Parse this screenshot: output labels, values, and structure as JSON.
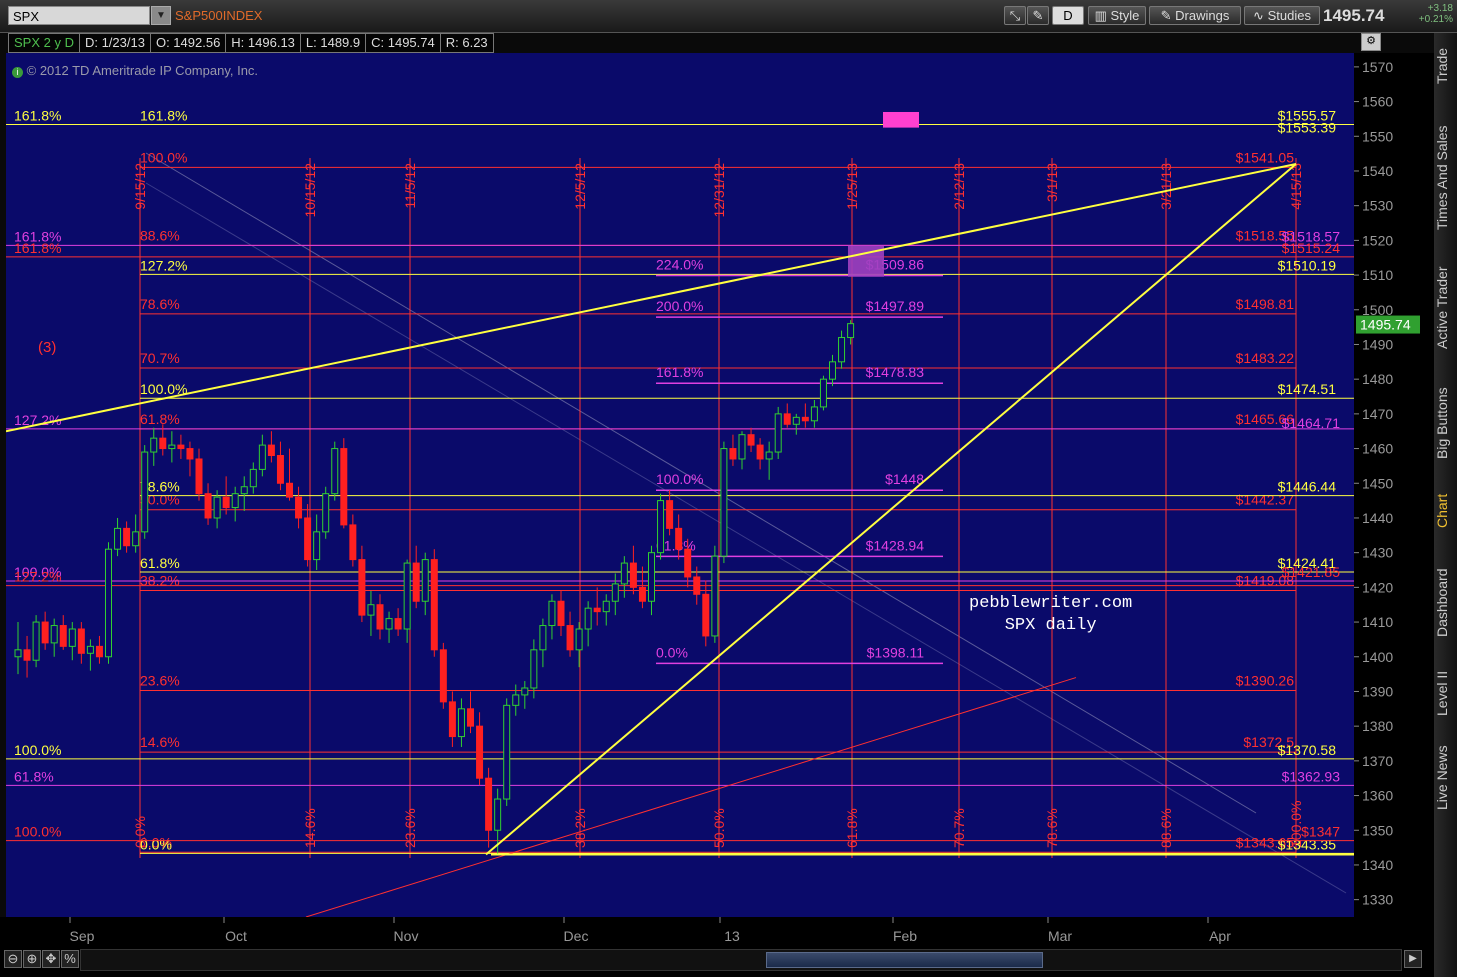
{
  "toolbar": {
    "symbol": "SPX",
    "index_name": "S&P500INDEX",
    "d_button": "D",
    "style_label": "Style",
    "drawings_label": "Drawings",
    "studies_label": "Studies",
    "last_price": "1495.74",
    "change": "+3.18",
    "change_pct": "+0.21%"
  },
  "infobar": {
    "symbol_period": "SPX 2 y D",
    "date": "D: 1/23/13",
    "open": "O: 1492.56",
    "high": "H: 1496.13",
    "low": "L: 1489.9",
    "close": "C: 1495.74",
    "range": "R: 6.23",
    "copyright": "2012 TD Ameritrade IP Company, Inc."
  },
  "side_tabs": [
    "Trade",
    "Times And Sales",
    "Active Trader",
    "Big Buttons",
    "Chart",
    "Dashboard",
    "Level II",
    "Live News"
  ],
  "watermark": {
    "line1": "pebblewriter.com",
    "line2": "SPX daily"
  },
  "wave_label": "(3)",
  "colors": {
    "background": "#0a0a6a",
    "red": "#ff3030",
    "yellow": "#ffff40",
    "magenta": "#e040e0",
    "up": "#30d030",
    "down": "#ff2020"
  },
  "chart_data": {
    "type": "candlestick",
    "y_ticks": [
      1330,
      1340,
      1350,
      1360,
      1370,
      1380,
      1390,
      1400,
      1410,
      1420,
      1430,
      1440,
      1450,
      1460,
      1470,
      1480,
      1490,
      1500,
      1510,
      1520,
      1530,
      1540,
      1550,
      1560,
      1570
    ],
    "ylim": [
      1325,
      1574
    ],
    "x_labels": [
      "Sep",
      "Oct",
      "Nov",
      "Dec",
      "13",
      "Feb",
      "Mar",
      "Apr"
    ],
    "price_tag": "1495.74",
    "date_lines": [
      "9/15/12",
      "10/15/12",
      "11/5/12",
      "12/5/12",
      "12/31/12",
      "1/25/13",
      "2/12/13",
      "3/1/13",
      "3/21/13",
      "4/15/13"
    ],
    "time_fib_labels": [
      "0.0%",
      "14.6%",
      "23.6%",
      "38.2%",
      "50.0%",
      "61.8%",
      "70.7%",
      "78.6%",
      "88.6%",
      "100.0%"
    ],
    "red_fib_left": [
      "100.0%",
      "88.6%",
      "78.6%",
      "70.7%",
      "61.8%",
      "50.0%",
      "38.2%",
      "23.6%",
      "14.6%",
      "0.0%"
    ],
    "red_fib_right": [
      "$1541.05",
      "$1518.55",
      "$1498.81",
      "$1483.22",
      "$1465.66",
      "$1442.37",
      "$1419.08",
      "$1390.26",
      "$1372.5",
      "$1343.65"
    ],
    "yellow_fib_left": [
      "161.8%",
      "127.2%",
      "100.0%",
      "78.6%",
      "61.8%",
      "100.0%"
    ],
    "yellow_fib_right": [
      "$1555.57",
      "$1553.39",
      "$1510.19",
      "$1474.51",
      "$1446.44",
      "$1424.41",
      "$1370.58",
      "$1343.35"
    ],
    "magenta_fib_left": [
      "224.0%",
      "200.0%",
      "161.8%",
      "100.0%",
      "61.8%",
      "0.0%"
    ],
    "magenta_fib_right": [
      "$1509.86",
      "$1497.89",
      "$1478.83",
      "$1448",
      "$1428.94",
      "$1398.11"
    ],
    "outer_left_labels": [
      "161.8%",
      "161.8%",
      "127.2%",
      "127.2%",
      "100.0%",
      "61.8%",
      "100.0%",
      "100.0%"
    ],
    "right_extra_labels": [
      "$1518.57",
      "$1515.24",
      "$1464.71",
      "$1362.93",
      "$1347",
      "$1421.85"
    ],
    "candles": [
      [
        1400,
        1410,
        1395,
        1402
      ],
      [
        1402,
        1406,
        1394,
        1399
      ],
      [
        1399,
        1412,
        1397,
        1410
      ],
      [
        1410,
        1413,
        1402,
        1404
      ],
      [
        1404,
        1411,
        1400,
        1409
      ],
      [
        1409,
        1412,
        1402,
        1403
      ],
      [
        1403,
        1410,
        1399,
        1408
      ],
      [
        1408,
        1410,
        1398,
        1401
      ],
      [
        1401,
        1405,
        1396,
        1403
      ],
      [
        1403,
        1406,
        1398,
        1400
      ],
      [
        1400,
        1433,
        1398,
        1431
      ],
      [
        1431,
        1440,
        1429,
        1437
      ],
      [
        1437,
        1439,
        1430,
        1432
      ],
      [
        1432,
        1441,
        1430,
        1436
      ],
      [
        1436,
        1461,
        1434,
        1459
      ],
      [
        1459,
        1466,
        1455,
        1463
      ],
      [
        1463,
        1467,
        1458,
        1460
      ],
      [
        1460,
        1465,
        1456,
        1461
      ],
      [
        1461,
        1464,
        1457,
        1460
      ],
      [
        1460,
        1462,
        1452,
        1457
      ],
      [
        1457,
        1460,
        1445,
        1447
      ],
      [
        1447,
        1450,
        1438,
        1440
      ],
      [
        1440,
        1448,
        1437,
        1446
      ],
      [
        1446,
        1452,
        1441,
        1443
      ],
      [
        1443,
        1449,
        1439,
        1447
      ],
      [
        1447,
        1452,
        1442,
        1449
      ],
      [
        1449,
        1456,
        1447,
        1454
      ],
      [
        1454,
        1464,
        1452,
        1461
      ],
      [
        1461,
        1465,
        1456,
        1458
      ],
      [
        1458,
        1462,
        1448,
        1450
      ],
      [
        1450,
        1460,
        1445,
        1446
      ],
      [
        1446,
        1449,
        1437,
        1440
      ],
      [
        1440,
        1444,
        1426,
        1428
      ],
      [
        1428,
        1441,
        1425,
        1436
      ],
      [
        1436,
        1449,
        1434,
        1447
      ],
      [
        1447,
        1462,
        1445,
        1460
      ],
      [
        1460,
        1463,
        1437,
        1438
      ],
      [
        1438,
        1441,
        1426,
        1428
      ],
      [
        1428,
        1432,
        1410,
        1412
      ],
      [
        1412,
        1419,
        1406,
        1415
      ],
      [
        1415,
        1418,
        1405,
        1408
      ],
      [
        1408,
        1413,
        1404,
        1411
      ],
      [
        1411,
        1414,
        1406,
        1408
      ],
      [
        1408,
        1428,
        1404,
        1427
      ],
      [
        1427,
        1432,
        1414,
        1416
      ],
      [
        1416,
        1430,
        1412,
        1428
      ],
      [
        1428,
        1431,
        1400,
        1402
      ],
      [
        1402,
        1404,
        1385,
        1387
      ],
      [
        1387,
        1390,
        1374,
        1377
      ],
      [
        1377,
        1388,
        1374,
        1385
      ],
      [
        1385,
        1390,
        1378,
        1380
      ],
      [
        1380,
        1384,
        1363,
        1365
      ],
      [
        1365,
        1368,
        1345,
        1350
      ],
      [
        1350,
        1362,
        1343,
        1359
      ],
      [
        1359,
        1388,
        1357,
        1386
      ],
      [
        1386,
        1392,
        1383,
        1389
      ],
      [
        1389,
        1393,
        1385,
        1391
      ],
      [
        1391,
        1405,
        1388,
        1402
      ],
      [
        1402,
        1411,
        1397,
        1409
      ],
      [
        1409,
        1418,
        1405,
        1416
      ],
      [
        1416,
        1419,
        1406,
        1409
      ],
      [
        1409,
        1413,
        1400,
        1402
      ],
      [
        1402,
        1410,
        1397,
        1408
      ],
      [
        1408,
        1416,
        1403,
        1414
      ],
      [
        1414,
        1420,
        1409,
        1413
      ],
      [
        1413,
        1418,
        1409,
        1416
      ],
      [
        1416,
        1424,
        1412,
        1421
      ],
      [
        1421,
        1429,
        1417,
        1427
      ],
      [
        1427,
        1432,
        1418,
        1420
      ],
      [
        1420,
        1426,
        1414,
        1416
      ],
      [
        1416,
        1432,
        1412,
        1430
      ],
      [
        1430,
        1447,
        1428,
        1445
      ],
      [
        1445,
        1448,
        1435,
        1437
      ],
      [
        1437,
        1441,
        1428,
        1431
      ],
      [
        1431,
        1434,
        1420,
        1423
      ],
      [
        1423,
        1426,
        1415,
        1418
      ],
      [
        1418,
        1422,
        1403,
        1406
      ],
      [
        1406,
        1432,
        1404,
        1429
      ],
      [
        1429,
        1462,
        1427,
        1460
      ],
      [
        1460,
        1464,
        1455,
        1457
      ],
      [
        1457,
        1465,
        1454,
        1464
      ],
      [
        1464,
        1466,
        1459,
        1461
      ],
      [
        1461,
        1463,
        1454,
        1457
      ],
      [
        1457,
        1462,
        1451,
        1459
      ],
      [
        1459,
        1472,
        1457,
        1470
      ],
      [
        1470,
        1473,
        1466,
        1467
      ],
      [
        1467,
        1470,
        1464,
        1469
      ],
      [
        1469,
        1473,
        1466,
        1468
      ],
      [
        1468,
        1474,
        1466,
        1472
      ],
      [
        1472,
        1481,
        1471,
        1480
      ],
      [
        1480,
        1487,
        1478,
        1485
      ],
      [
        1485,
        1494,
        1483,
        1492
      ],
      [
        1492,
        1497,
        1490,
        1496
      ]
    ]
  }
}
